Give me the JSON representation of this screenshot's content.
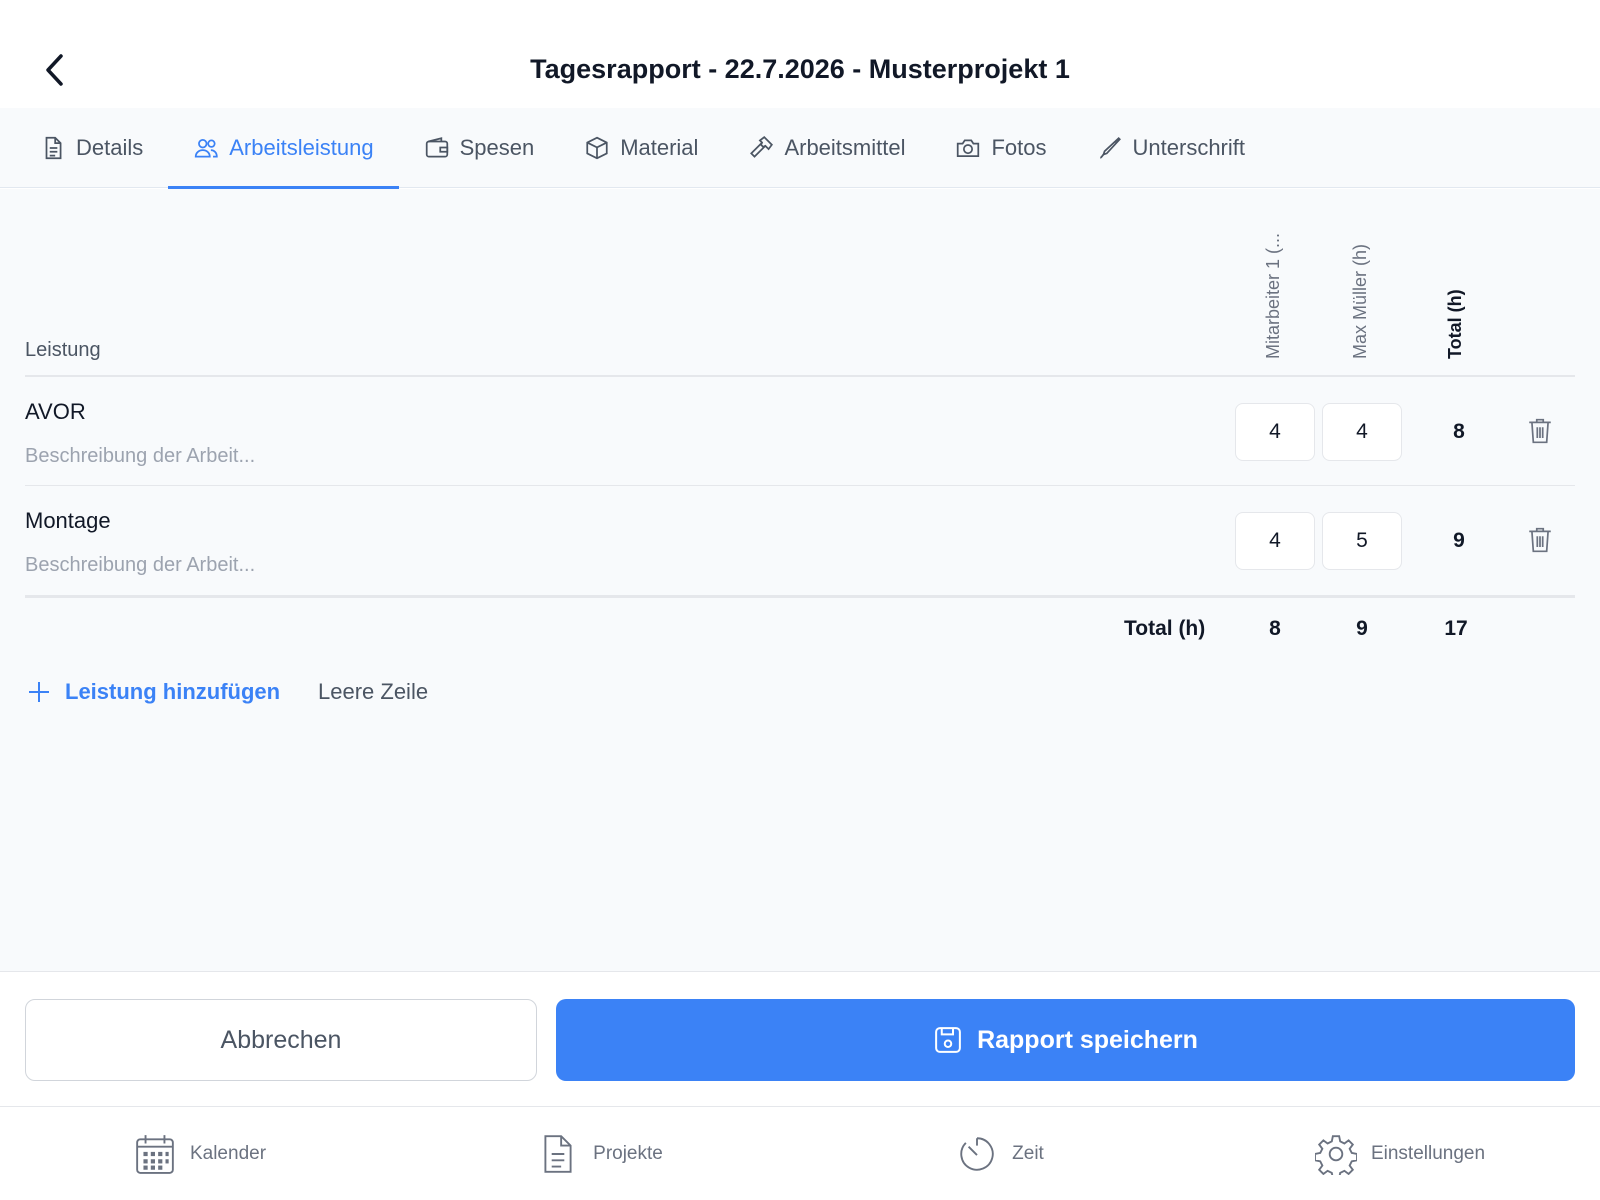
{
  "header": {
    "title": "Tagesrapport - 22.7.2026 - Musterprojekt 1"
  },
  "tabs": [
    {
      "label": "Details",
      "icon": "document-icon"
    },
    {
      "label": "Arbeitsleistung",
      "icon": "users-icon",
      "active": true
    },
    {
      "label": "Spesen",
      "icon": "wallet-icon"
    },
    {
      "label": "Material",
      "icon": "box-icon"
    },
    {
      "label": "Arbeitsmittel",
      "icon": "hammer-icon"
    },
    {
      "label": "Fotos",
      "icon": "camera-icon"
    },
    {
      "label": "Unterschrift",
      "icon": "pen-icon"
    }
  ],
  "table": {
    "column_leistung": "Leistung",
    "columns": [
      "Mitarbeiter 1 (...",
      "Max Müller (h)",
      "Total (h)"
    ],
    "rows": [
      {
        "name": "AVOR",
        "description_placeholder": "Beschreibung der Arbeit...",
        "hours": [
          "4",
          "4"
        ],
        "total": "8"
      },
      {
        "name": "Montage",
        "description_placeholder": "Beschreibung der Arbeit...",
        "hours": [
          "4",
          "5"
        ],
        "total": "9"
      }
    ],
    "totals": {
      "label": "Total (h)",
      "values": [
        "8",
        "9",
        "17"
      ]
    }
  },
  "actions": {
    "add_label": "Leistung hinzufügen",
    "empty_row_label": "Leere Zeile",
    "cancel_label": "Abbrechen",
    "save_label": "Rapport speichern"
  },
  "nav": [
    {
      "label": "Kalender",
      "icon": "calendar-icon"
    },
    {
      "label": "Projekte",
      "icon": "document-icon"
    },
    {
      "label": "Zeit",
      "icon": "timer-icon"
    },
    {
      "label": "Einstellungen",
      "icon": "gear-icon"
    }
  ],
  "colors": {
    "accent": "#3b82f6",
    "text": "#111827",
    "muted": "#6b7280",
    "background": "#f8fafc"
  }
}
